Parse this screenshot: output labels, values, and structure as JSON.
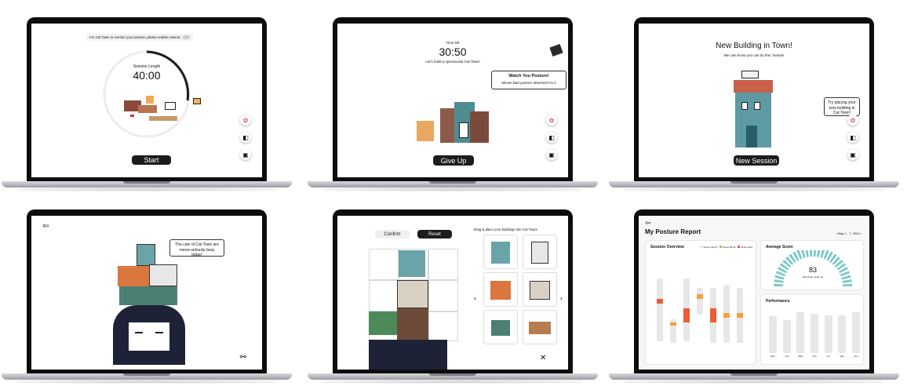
{
  "screens": {
    "s1": {
      "camera_notice": "For Cat Town to monitor your posture, please enable camera",
      "session_label": "Session Length",
      "session_time": "40:00",
      "start_label": "Start"
    },
    "s2": {
      "time_left_label": "Time left",
      "time": "30:50",
      "subtitle": "Let's build a spectacular Cat Town!",
      "warn_title": "Watch You Posture!",
      "warn_body": "Meow! Bad posture detected! Fix it",
      "give_up_label": "Give Up"
    },
    "s3": {
      "title": "New Building in Town!",
      "subtitle": "We cats know you can do this, human!",
      "tip": "Try placing your new building in Cat Town!",
      "new_session_label": "New Session"
    },
    "s4": {
      "bubble": "The cats of Cat Town are meow-velously busy today!"
    },
    "s5": {
      "confirm_label": "Confirm",
      "reset_label": "Reset",
      "instruction": "Drag & place your buildings into Cat Town!"
    },
    "s6": {
      "title": "My Posture Report",
      "date_range": "May 1 - 7, 2024",
      "overview_title": "Session Overview",
      "legend": [
        "Score 100-70",
        "Score 69-40",
        "Score 39-0"
      ],
      "average_title": "Average Score",
      "average_value": "83",
      "average_caption": "Well done, keep up!",
      "performance_title": "Performance",
      "days": [
        "Mon",
        "Tue",
        "Wed",
        "Thu",
        "Fri",
        "Sat",
        "Sun"
      ]
    }
  },
  "chart_data": {
    "type": "bar",
    "categories": [
      "Mon",
      "Tue",
      "Wed",
      "Thu",
      "Fri",
      "Sat",
      "Sun"
    ],
    "values": [
      78,
      70,
      86,
      84,
      80,
      80,
      86
    ],
    "title": "Performance"
  },
  "colors": {
    "dark_button": "#1c1c1c",
    "teal": "#7fc9c7",
    "good": "#e5e7e8",
    "mid": "#f4a13c",
    "bad": "#ef5b34",
    "bezel": "#0d0d0f"
  },
  "icons": [
    "paw-icon",
    "camera-icon",
    "gallery-icon",
    "back-arrow-icon",
    "chevron-left-icon",
    "chevron-right-icon",
    "close-icon",
    "bone-icon"
  ]
}
